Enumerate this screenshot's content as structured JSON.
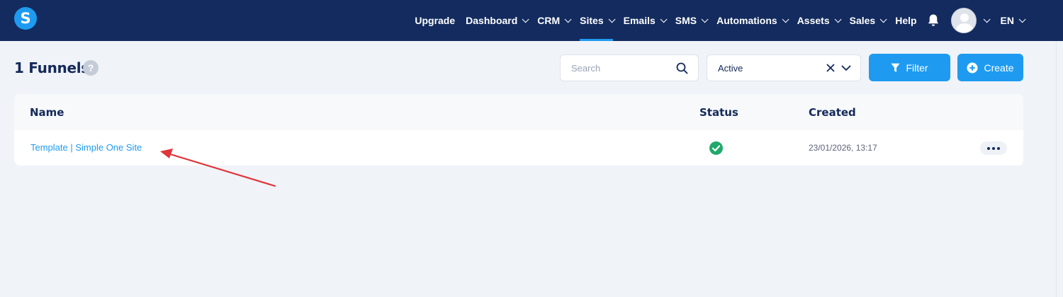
{
  "brand": {
    "logo_letter": "S"
  },
  "nav": {
    "items": [
      {
        "label": "Upgrade",
        "dropdown": false,
        "active": false
      },
      {
        "label": "Dashboard",
        "dropdown": true,
        "active": false
      },
      {
        "label": "CRM",
        "dropdown": true,
        "active": false
      },
      {
        "label": "Sites",
        "dropdown": true,
        "active": true
      },
      {
        "label": "Emails",
        "dropdown": true,
        "active": false
      },
      {
        "label": "SMS",
        "dropdown": true,
        "active": false
      },
      {
        "label": "Automations",
        "dropdown": true,
        "active": false
      },
      {
        "label": "Assets",
        "dropdown": true,
        "active": false
      },
      {
        "label": "Sales",
        "dropdown": true,
        "active": false
      },
      {
        "label": "Help",
        "dropdown": false,
        "active": false
      }
    ],
    "language": "EN",
    "icons": {
      "notifications": "bell-icon",
      "avatar": "user-avatar-icon"
    }
  },
  "page": {
    "title": "1 Funnels",
    "help_glyph": "?"
  },
  "toolbar": {
    "search_placeholder": "Search",
    "status_filter_value": "Active",
    "filter_label": "Filter",
    "create_label": "Create"
  },
  "table": {
    "columns": [
      "Name",
      "Status",
      "Created"
    ],
    "rows": [
      {
        "name": "Template | Simple One Site",
        "status": "active",
        "created": "23/01/2026, 13:17"
      }
    ]
  },
  "colors": {
    "nav_bg": "#132b5e",
    "accent": "#1e9bf0",
    "status_ok": "#20a96b",
    "annotation_arrow": "#e0353a"
  }
}
